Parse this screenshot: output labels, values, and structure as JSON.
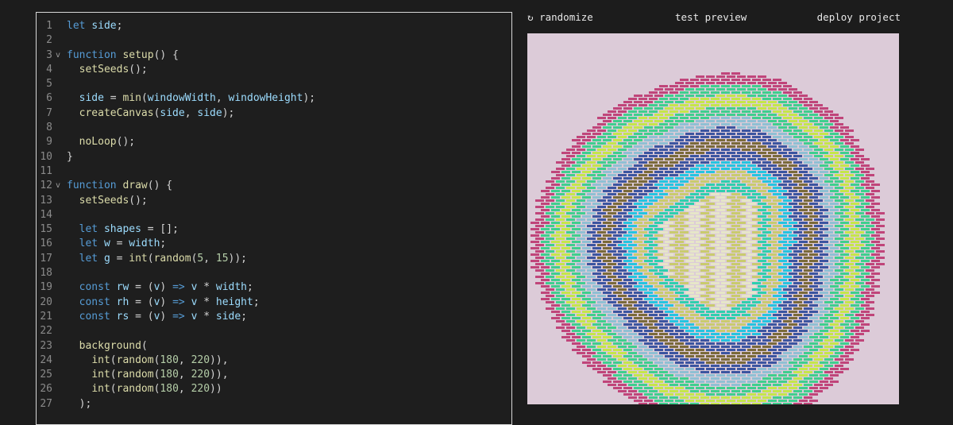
{
  "toolbar": {
    "randomize_icon": "↻",
    "randomize_label": "randomize",
    "test_label": "test preview",
    "deploy_label": "deploy project"
  },
  "editor": {
    "lines": [
      {
        "n": "1",
        "fold": "",
        "tokens": [
          [
            "kw",
            "let"
          ],
          [
            "op",
            " "
          ],
          [
            "var",
            "side"
          ],
          [
            "op",
            ";"
          ]
        ]
      },
      {
        "n": "2",
        "fold": "",
        "tokens": []
      },
      {
        "n": "3",
        "fold": "v",
        "tokens": [
          [
            "kw",
            "function"
          ],
          [
            "op",
            " "
          ],
          [
            "fn",
            "setup"
          ],
          [
            "op",
            "() {"
          ]
        ]
      },
      {
        "n": "4",
        "fold": "",
        "tokens": [
          [
            "op",
            "  "
          ],
          [
            "fn",
            "setSeeds"
          ],
          [
            "op",
            "();"
          ]
        ]
      },
      {
        "n": "5",
        "fold": "",
        "tokens": []
      },
      {
        "n": "6",
        "fold": "",
        "tokens": [
          [
            "op",
            "  "
          ],
          [
            "var",
            "side"
          ],
          [
            "op",
            " = "
          ],
          [
            "fn",
            "min"
          ],
          [
            "op",
            "("
          ],
          [
            "var",
            "windowWidth"
          ],
          [
            "op",
            ", "
          ],
          [
            "var",
            "windowHeight"
          ],
          [
            "op",
            ");"
          ]
        ]
      },
      {
        "n": "7",
        "fold": "",
        "tokens": [
          [
            "op",
            "  "
          ],
          [
            "fn",
            "createCanvas"
          ],
          [
            "op",
            "("
          ],
          [
            "var",
            "side"
          ],
          [
            "op",
            ", "
          ],
          [
            "var",
            "side"
          ],
          [
            "op",
            ");"
          ]
        ]
      },
      {
        "n": "8",
        "fold": "",
        "tokens": []
      },
      {
        "n": "9",
        "fold": "",
        "tokens": [
          [
            "op",
            "  "
          ],
          [
            "fn",
            "noLoop"
          ],
          [
            "op",
            "();"
          ]
        ]
      },
      {
        "n": "10",
        "fold": "",
        "tokens": [
          [
            "op",
            "}"
          ]
        ]
      },
      {
        "n": "11",
        "fold": "",
        "tokens": []
      },
      {
        "n": "12",
        "fold": "v",
        "tokens": [
          [
            "kw",
            "function"
          ],
          [
            "op",
            " "
          ],
          [
            "fn",
            "draw"
          ],
          [
            "op",
            "() {"
          ]
        ]
      },
      {
        "n": "13",
        "fold": "",
        "tokens": [
          [
            "op",
            "  "
          ],
          [
            "fn",
            "setSeeds"
          ],
          [
            "op",
            "();"
          ]
        ]
      },
      {
        "n": "14",
        "fold": "",
        "tokens": []
      },
      {
        "n": "15",
        "fold": "",
        "tokens": [
          [
            "op",
            "  "
          ],
          [
            "kw",
            "let"
          ],
          [
            "op",
            " "
          ],
          [
            "var",
            "shapes"
          ],
          [
            "op",
            " = [];"
          ]
        ]
      },
      {
        "n": "16",
        "fold": "",
        "tokens": [
          [
            "op",
            "  "
          ],
          [
            "kw",
            "let"
          ],
          [
            "op",
            " "
          ],
          [
            "var",
            "w"
          ],
          [
            "op",
            " = "
          ],
          [
            "var",
            "width"
          ],
          [
            "op",
            ";"
          ]
        ]
      },
      {
        "n": "17",
        "fold": "",
        "tokens": [
          [
            "op",
            "  "
          ],
          [
            "kw",
            "let"
          ],
          [
            "op",
            " "
          ],
          [
            "var",
            "g"
          ],
          [
            "op",
            " = "
          ],
          [
            "fn",
            "int"
          ],
          [
            "op",
            "("
          ],
          [
            "fn",
            "random"
          ],
          [
            "op",
            "("
          ],
          [
            "num",
            "5"
          ],
          [
            "op",
            ", "
          ],
          [
            "num",
            "15"
          ],
          [
            "op",
            "));"
          ]
        ]
      },
      {
        "n": "18",
        "fold": "",
        "tokens": []
      },
      {
        "n": "19",
        "fold": "",
        "tokens": [
          [
            "op",
            "  "
          ],
          [
            "kw",
            "const"
          ],
          [
            "op",
            " "
          ],
          [
            "var",
            "rw"
          ],
          [
            "op",
            " = ("
          ],
          [
            "var",
            "v"
          ],
          [
            "op",
            ") "
          ],
          [
            "kw",
            "=>"
          ],
          [
            "op",
            " "
          ],
          [
            "var",
            "v"
          ],
          [
            "op",
            " * "
          ],
          [
            "var",
            "width"
          ],
          [
            "op",
            ";"
          ]
        ]
      },
      {
        "n": "20",
        "fold": "",
        "tokens": [
          [
            "op",
            "  "
          ],
          [
            "kw",
            "const"
          ],
          [
            "op",
            " "
          ],
          [
            "var",
            "rh"
          ],
          [
            "op",
            " = ("
          ],
          [
            "var",
            "v"
          ],
          [
            "op",
            ") "
          ],
          [
            "kw",
            "=>"
          ],
          [
            "op",
            " "
          ],
          [
            "var",
            "v"
          ],
          [
            "op",
            " * "
          ],
          [
            "var",
            "height"
          ],
          [
            "op",
            ";"
          ]
        ]
      },
      {
        "n": "21",
        "fold": "",
        "tokens": [
          [
            "op",
            "  "
          ],
          [
            "kw",
            "const"
          ],
          [
            "op",
            " "
          ],
          [
            "var",
            "rs"
          ],
          [
            "op",
            " = ("
          ],
          [
            "var",
            "v"
          ],
          [
            "op",
            ") "
          ],
          [
            "kw",
            "=>"
          ],
          [
            "op",
            " "
          ],
          [
            "var",
            "v"
          ],
          [
            "op",
            " * "
          ],
          [
            "var",
            "side"
          ],
          [
            "op",
            ";"
          ]
        ]
      },
      {
        "n": "22",
        "fold": "",
        "tokens": []
      },
      {
        "n": "23",
        "fold": "",
        "tokens": [
          [
            "op",
            "  "
          ],
          [
            "fn",
            "background"
          ],
          [
            "op",
            "("
          ]
        ]
      },
      {
        "n": "24",
        "fold": "",
        "tokens": [
          [
            "op",
            "    "
          ],
          [
            "fn",
            "int"
          ],
          [
            "op",
            "("
          ],
          [
            "fn",
            "random"
          ],
          [
            "op",
            "("
          ],
          [
            "num",
            "180"
          ],
          [
            "op",
            ", "
          ],
          [
            "num",
            "220"
          ],
          [
            "op",
            ")),"
          ]
        ]
      },
      {
        "n": "25",
        "fold": "",
        "tokens": [
          [
            "op",
            "    "
          ],
          [
            "fn",
            "int"
          ],
          [
            "op",
            "("
          ],
          [
            "fn",
            "random"
          ],
          [
            "op",
            "("
          ],
          [
            "num",
            "180"
          ],
          [
            "op",
            ", "
          ],
          [
            "num",
            "220"
          ],
          [
            "op",
            ")),"
          ]
        ]
      },
      {
        "n": "26",
        "fold": "",
        "tokens": [
          [
            "op",
            "    "
          ],
          [
            "fn",
            "int"
          ],
          [
            "op",
            "("
          ],
          [
            "fn",
            "random"
          ],
          [
            "op",
            "("
          ],
          [
            "num",
            "180"
          ],
          [
            "op",
            ", "
          ],
          [
            "num",
            "220"
          ],
          [
            "op",
            "))"
          ]
        ]
      },
      {
        "n": "27",
        "fold": "",
        "tokens": [
          [
            "op",
            "  );"
          ]
        ]
      }
    ]
  },
  "preview": {
    "background": "#dccbd8",
    "ring_colors": [
      "#c0457a",
      "#3fcf8e",
      "#c5e64a",
      "#3fcf8e",
      "#8fc0d3",
      "#3c55a0",
      "#7a6a3a",
      "#3c55a0",
      "#25c4e0",
      "#c9cb6e",
      "#2fcfae"
    ]
  }
}
